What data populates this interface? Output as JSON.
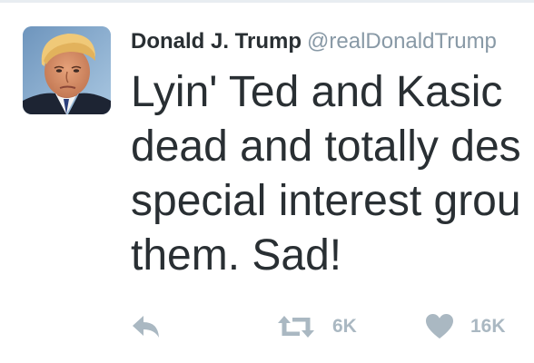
{
  "tweet": {
    "author_name": "Donald J. Trump",
    "author_handle": "@realDonaldTrump",
    "text": "Lyin' Ted and Kasic\ndead and totally des\nspecial interest grou\nthem. Sad!"
  },
  "actions": {
    "reply_icon": "reply-icon",
    "retweet_icon": "retweet-icon",
    "retweet_count": "6K",
    "like_icon": "heart-icon",
    "like_count": "16K"
  },
  "colors": {
    "text": "#292f33",
    "muted": "#8899a6",
    "action": "#aab8c2"
  }
}
